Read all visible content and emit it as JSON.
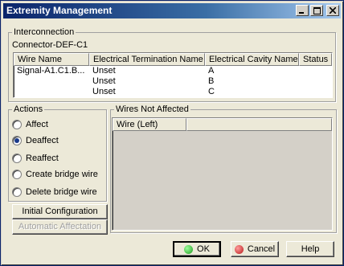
{
  "window": {
    "title": "Extremity Management"
  },
  "interconnection": {
    "legend": "Interconnection",
    "connector": "Connector-DEF-C1",
    "columns": [
      "Wire Name",
      "Electrical Termination Name",
      "Electrical Cavity Name",
      "Status"
    ],
    "rows": [
      [
        "Signal-A1.C1.B...",
        "Unset",
        "A",
        ""
      ],
      [
        "",
        "Unset",
        "B",
        ""
      ],
      [
        "",
        "Unset",
        "C",
        ""
      ]
    ]
  },
  "actions": {
    "legend": "Actions",
    "options": [
      "Affect",
      "Deaffect",
      "Reaffect",
      "Create bridge wire",
      "Delete bridge wire"
    ],
    "selected": "Deaffect",
    "initial_config_label": "Initial Configuration",
    "auto_affect_label": "Automatic Affectation"
  },
  "wires_not_affected": {
    "legend": "Wires Not Affected",
    "columns": [
      "Wire (Left)"
    ]
  },
  "footer": {
    "ok_label": "OK",
    "cancel_label": "Cancel",
    "help_label": "Help"
  },
  "colors": {
    "title_start": "#0a246a",
    "ok_icon": "#22aa22",
    "cancel_icon": "#cc2222",
    "dialog_bg": "#ece9d8"
  }
}
